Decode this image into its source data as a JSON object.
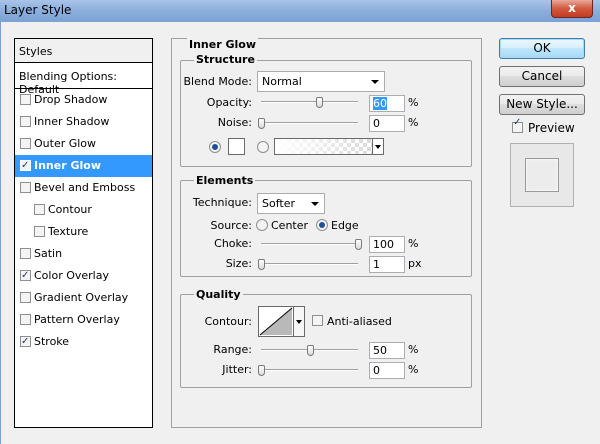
{
  "window": {
    "title": "Layer Style",
    "close_glyph": "x"
  },
  "styles": {
    "header": "Styles",
    "blending": "Blending Options: Default",
    "items": [
      {
        "label": "Drop Shadow",
        "checked": false,
        "sub": false,
        "selected": false
      },
      {
        "label": "Inner Shadow",
        "checked": false,
        "sub": false,
        "selected": false
      },
      {
        "label": "Outer Glow",
        "checked": false,
        "sub": false,
        "selected": false
      },
      {
        "label": "Inner Glow",
        "checked": true,
        "sub": false,
        "selected": true
      },
      {
        "label": "Bevel and Emboss",
        "checked": false,
        "sub": false,
        "selected": false
      },
      {
        "label": "Contour",
        "checked": false,
        "sub": true,
        "selected": false
      },
      {
        "label": "Texture",
        "checked": false,
        "sub": true,
        "selected": false
      },
      {
        "label": "Satin",
        "checked": false,
        "sub": false,
        "selected": false
      },
      {
        "label": "Color Overlay",
        "checked": true,
        "sub": false,
        "selected": false
      },
      {
        "label": "Gradient Overlay",
        "checked": false,
        "sub": false,
        "selected": false
      },
      {
        "label": "Pattern Overlay",
        "checked": false,
        "sub": false,
        "selected": false
      },
      {
        "label": "Stroke",
        "checked": true,
        "sub": false,
        "selected": false
      }
    ]
  },
  "panel": {
    "title": "Inner Glow",
    "structure": {
      "title": "Structure",
      "blend_mode_label": "Blend Mode:",
      "blend_mode_value": "Normal",
      "opacity_label": "Opacity:",
      "opacity_value": "60",
      "opacity_fraction": 0.6,
      "opacity_unit": "%",
      "noise_label": "Noise:",
      "noise_value": "0",
      "noise_fraction": 0,
      "noise_unit": "%"
    },
    "elements": {
      "title": "Elements",
      "technique_label": "Technique:",
      "technique_value": "Softer",
      "source_label": "Source:",
      "source_center": "Center",
      "source_edge": "Edge",
      "choke_label": "Choke:",
      "choke_value": "100",
      "choke_fraction": 1.0,
      "choke_unit": "%",
      "size_label": "Size:",
      "size_value": "1",
      "size_fraction": 0,
      "size_unit": "px"
    },
    "quality": {
      "title": "Quality",
      "contour_label": "Contour:",
      "anti_aliased_label": "Anti-aliased",
      "range_label": "Range:",
      "range_value": "50",
      "range_fraction": 0.5,
      "range_unit": "%",
      "jitter_label": "Jitter:",
      "jitter_value": "0",
      "jitter_fraction": 0,
      "jitter_unit": "%"
    }
  },
  "buttons": {
    "ok": "OK",
    "cancel": "Cancel",
    "new_style": "New Style...",
    "preview": "Preview"
  },
  "colors": {
    "selection": "#3399ff",
    "titlebar": "#8db0dd",
    "close": "#c13b22"
  }
}
